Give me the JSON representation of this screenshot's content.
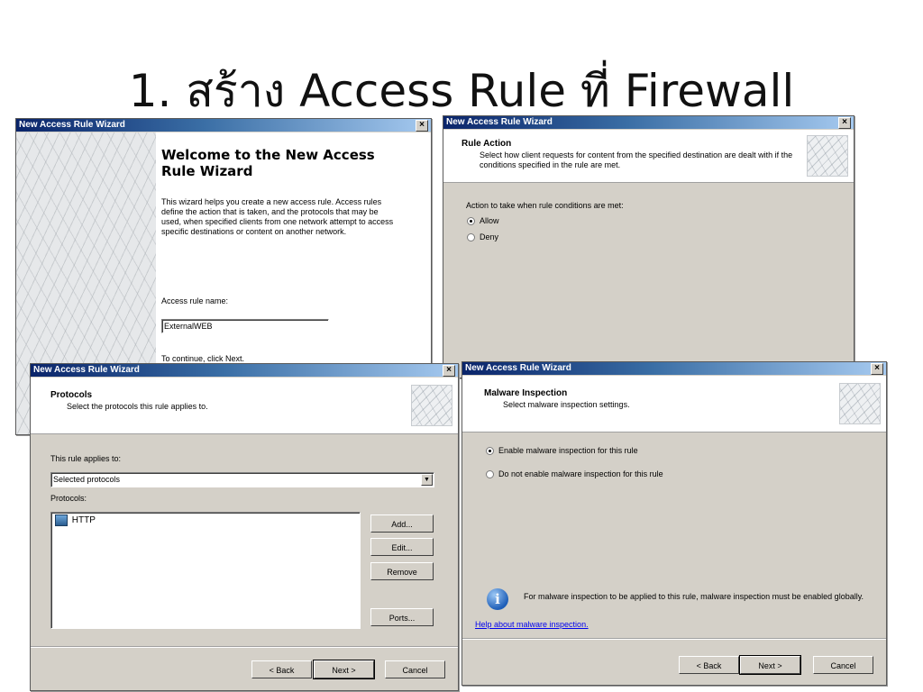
{
  "slide": {
    "title": "1. สร้าง Access Rule ที่ Firewall"
  },
  "welcome": {
    "window_title": "New Access Rule Wizard",
    "close": "×",
    "heading": "Welcome to the New Access Rule Wizard",
    "body": "This wizard helps you create a new access rule. Access rules define the action that is taken, and the protocols that may be used, when specified clients from one network attempt to access specific destinations or content on another network.",
    "name_label": "Access rule name:",
    "name_value": "ExternalWEB",
    "continue": "To continue, click Next."
  },
  "rule_action": {
    "window_title": "New Access Rule Wizard",
    "close": "×",
    "header_title": "Rule Action",
    "header_sub": "Select how client requests for content from the specified destination are dealt with if the conditions specified in the rule are met.",
    "prompt": "Action to take when rule conditions are met:",
    "options": [
      "Allow",
      "Deny"
    ],
    "selected": "Allow"
  },
  "protocols": {
    "window_title": "New Access Rule Wizard",
    "close": "×",
    "header_title": "Protocols",
    "header_sub": "Select the protocols this rule applies to.",
    "applies_label": "This rule applies to:",
    "applies_value": "Selected protocols",
    "protocols_label": "Protocols:",
    "items": [
      "HTTP"
    ],
    "buttons": {
      "add": "Add...",
      "edit": "Edit...",
      "remove": "Remove",
      "ports": "Ports..."
    },
    "footer": {
      "back": "< Back",
      "next": "Next >",
      "cancel": "Cancel"
    }
  },
  "malware": {
    "window_title": "New Access Rule Wizard",
    "close": "×",
    "header_title": "Malware Inspection",
    "header_sub": "Select malware inspection settings.",
    "options": [
      "Enable malware inspection for this rule",
      "Do not enable malware inspection for this rule"
    ],
    "selected": "Enable malware inspection for this rule",
    "info": "For malware inspection to be applied to this rule, malware inspection must be enabled globally.",
    "link": "Help about malware inspection.",
    "footer": {
      "back": "< Back",
      "next": "Next >",
      "cancel": "Cancel"
    }
  }
}
